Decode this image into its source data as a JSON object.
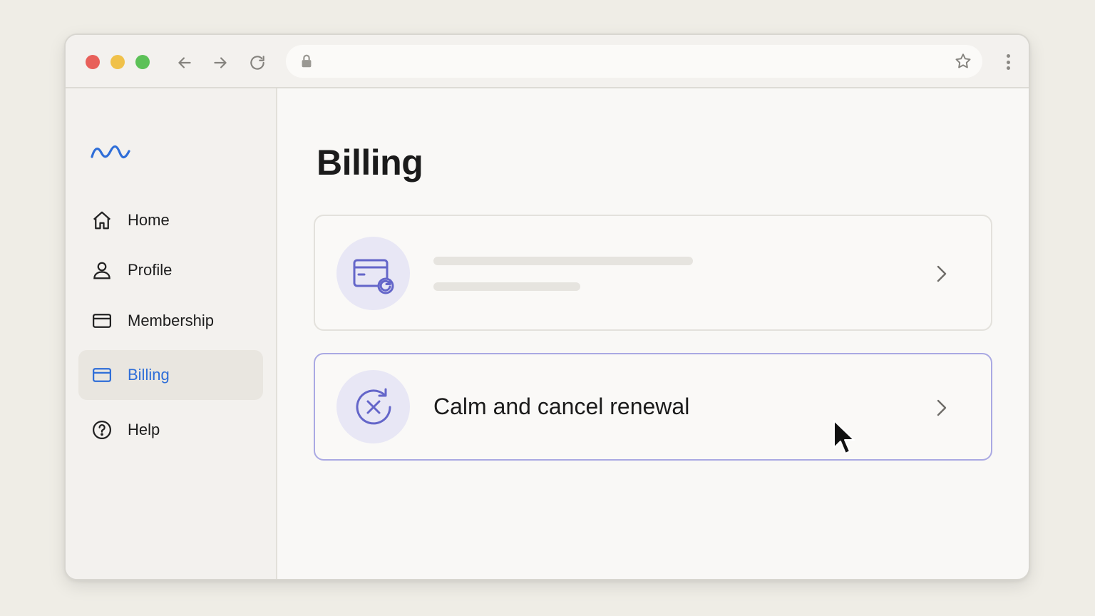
{
  "browser": {
    "url": "",
    "icons": {
      "back": "arrow-left-icon",
      "forward": "arrow-right-icon",
      "reload": "reload-icon",
      "lock": "lock-icon",
      "bookmark": "star-icon",
      "menu": "more-vertical-icon"
    }
  },
  "sidebar": {
    "logo": "wave-logo-icon",
    "items": [
      {
        "label": "Home",
        "icon": "home-icon",
        "active": false
      },
      {
        "label": "Profile",
        "icon": "user-icon",
        "active": false
      },
      {
        "label": "Membership",
        "icon": "card-icon",
        "active": false
      },
      {
        "label": "Billing",
        "icon": "card-icon",
        "active": true
      },
      {
        "label": "Help",
        "icon": "help-circle-icon",
        "active": false
      }
    ]
  },
  "main": {
    "title": "Billing",
    "cards": [
      {
        "label": "",
        "icon": "card-renew-icon",
        "loading": true
      },
      {
        "label": "Calm and cancel renewal",
        "icon": "cancel-renewal-icon",
        "loading": false
      }
    ]
  },
  "colors": {
    "accent": "#2f6ed8",
    "icon_purple": "#6466c9",
    "card_highlight_border": "#aaa9e3",
    "circle_bg": "#e8e7f5"
  }
}
